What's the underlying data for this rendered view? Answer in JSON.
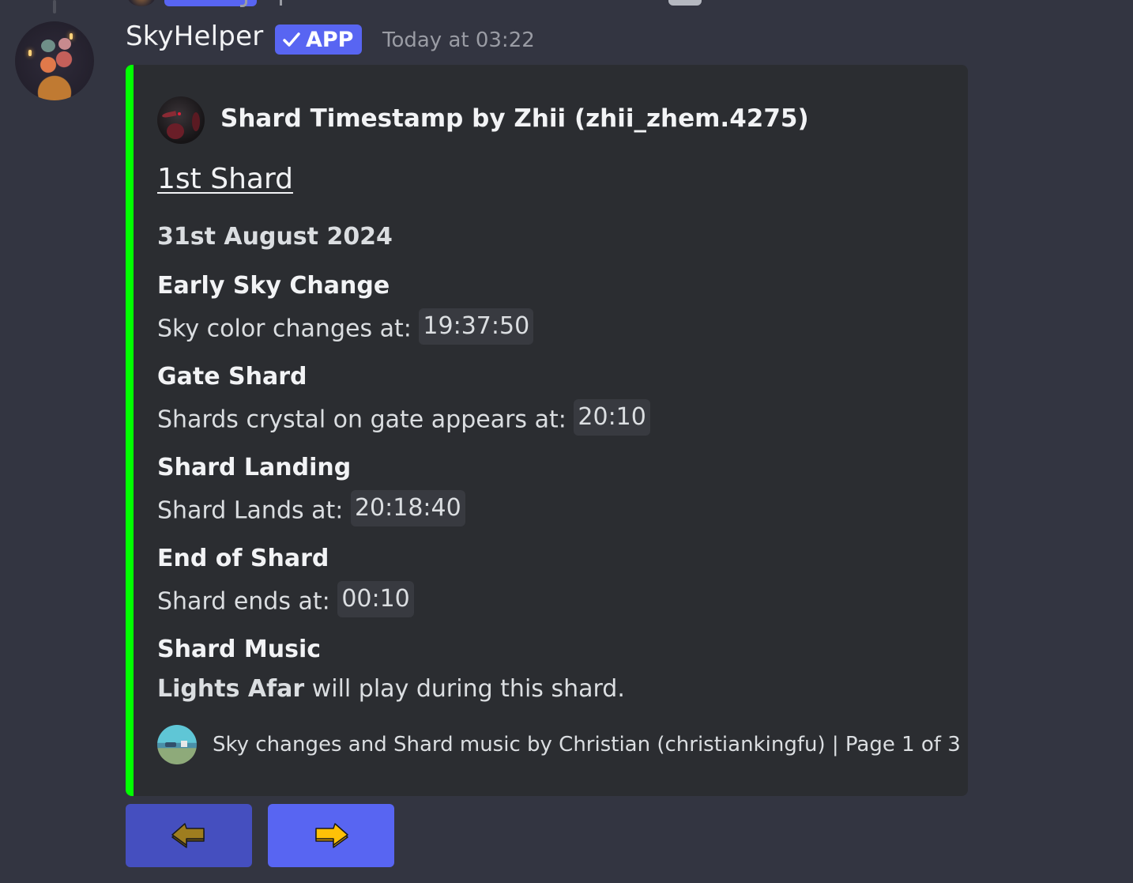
{
  "message": {
    "author": "SkyHelper",
    "badge": "APP",
    "badge_icon": "check-icon",
    "timestamp": "Today at 03:22",
    "avatar": "bot-avatar"
  },
  "embed": {
    "accent_color": "#00ff00",
    "author_name": "Shard Timestamp by Zhii (zhii_zhem.4275)",
    "title": "1st Shard",
    "date": "31st August 2024",
    "fields": [
      {
        "name": "Early Sky Change",
        "text": "Sky color changes at:",
        "code": "19:37:50"
      },
      {
        "name": "Gate Shard",
        "text": "Shards crystal on gate appears at:",
        "code": "20:10"
      },
      {
        "name": "Shard Landing",
        "text": "Shard Lands at:",
        "code": "20:18:40"
      },
      {
        "name": "End of Shard",
        "text": "Shard ends at:",
        "code": "00:10"
      },
      {
        "name": "Shard Music",
        "bold": "Lights Afar",
        "text": " will play during this shard."
      }
    ],
    "footer": "Sky changes and Shard music by Christian (christiankingfu) | Page 1 of 3"
  },
  "buttons": {
    "prev": {
      "icon": "arrow-left-icon",
      "color": "#454fbf",
      "arrow_color": "#9e7d1f"
    },
    "next": {
      "icon": "arrow-right-icon",
      "color": "#5865f2",
      "arrow_color": "#ffc107"
    }
  }
}
